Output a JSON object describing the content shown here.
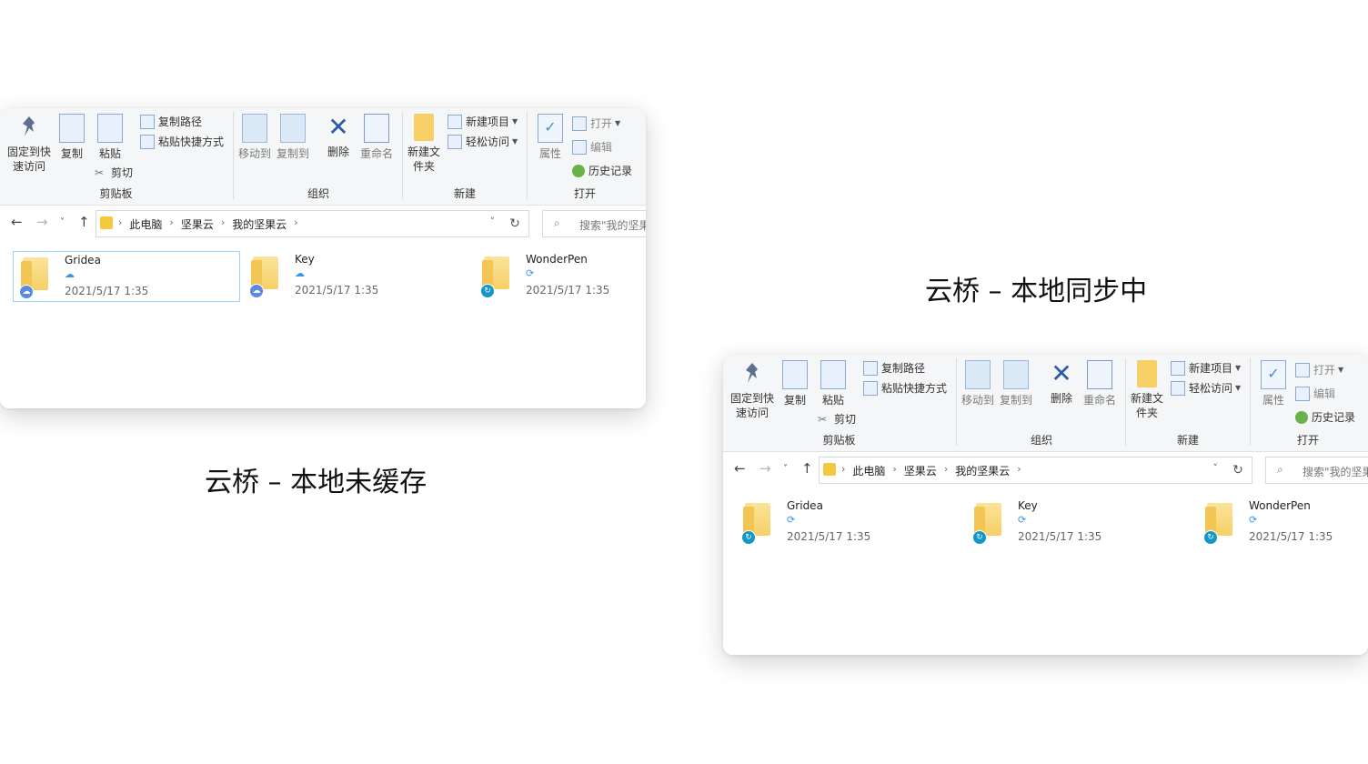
{
  "windows": [
    {
      "ribbon": {
        "clipboard": {
          "label": "剪贴板",
          "pin_label": "固定到快速访问",
          "copy_label": "复制",
          "paste_label": "粘贴",
          "copy_path_label": "复制路径",
          "paste_shortcut_label": "粘贴快捷方式",
          "cut_label": "剪切"
        },
        "organize": {
          "label": "组织",
          "move_to_label": "移动到",
          "copy_to_label": "复制到",
          "delete_label": "删除",
          "rename_label": "重命名"
        },
        "new": {
          "label": "新建",
          "new_folder_label": "新建文件夹",
          "new_item_label": "新建项目",
          "easy_access_label": "轻松访问"
        },
        "open": {
          "label": "打开",
          "properties_label": "属性",
          "open_label": "打开",
          "edit_label": "编辑",
          "history_label": "历史记录"
        }
      },
      "address": {
        "crumbs": [
          "此电脑",
          "坚果云",
          "我的坚果云"
        ],
        "search_placeholder": "搜索\"我的坚果"
      },
      "files": [
        {
          "name": "Gridea",
          "date": "2021/5/17 1:35",
          "status": "cloud",
          "selected": true
        },
        {
          "name": "Key",
          "date": "2021/5/17 1:35",
          "status": "cloud",
          "selected": false
        },
        {
          "name": "WonderPen",
          "date": "2021/5/17 1:35",
          "status": "sync",
          "selected": false
        }
      ]
    },
    {
      "ribbon": {
        "clipboard": {
          "label": "剪贴板",
          "pin_label": "固定到快速访问",
          "copy_label": "复制",
          "paste_label": "粘贴",
          "copy_path_label": "复制路径",
          "paste_shortcut_label": "粘贴快捷方式",
          "cut_label": "剪切"
        },
        "organize": {
          "label": "组织",
          "move_to_label": "移动到",
          "copy_to_label": "复制到",
          "delete_label": "删除",
          "rename_label": "重命名"
        },
        "new": {
          "label": "新建",
          "new_folder_label": "新建文件夹",
          "new_item_label": "新建项目",
          "easy_access_label": "轻松访问"
        },
        "open": {
          "label": "打开",
          "properties_label": "属性",
          "open_label": "打开",
          "edit_label": "编辑",
          "history_label": "历史记录"
        }
      },
      "address": {
        "crumbs": [
          "此电脑",
          "坚果云",
          "我的坚果云"
        ],
        "search_placeholder": "搜索\"我的坚果"
      },
      "files": [
        {
          "name": "Gridea",
          "date": "2021/5/17 1:35",
          "status": "sync",
          "selected": false
        },
        {
          "name": "Key",
          "date": "2021/5/17 1:35",
          "status": "sync",
          "selected": false
        },
        {
          "name": "WonderPen",
          "date": "2021/5/17 1:35",
          "status": "sync",
          "selected": false
        }
      ]
    }
  ],
  "captions": {
    "left": "云桥 – 本地未缓存",
    "right": "云桥 – 本地同步中"
  },
  "icons": {
    "cloud_status": "cloud-icon",
    "sync_status": "sync-icon"
  }
}
